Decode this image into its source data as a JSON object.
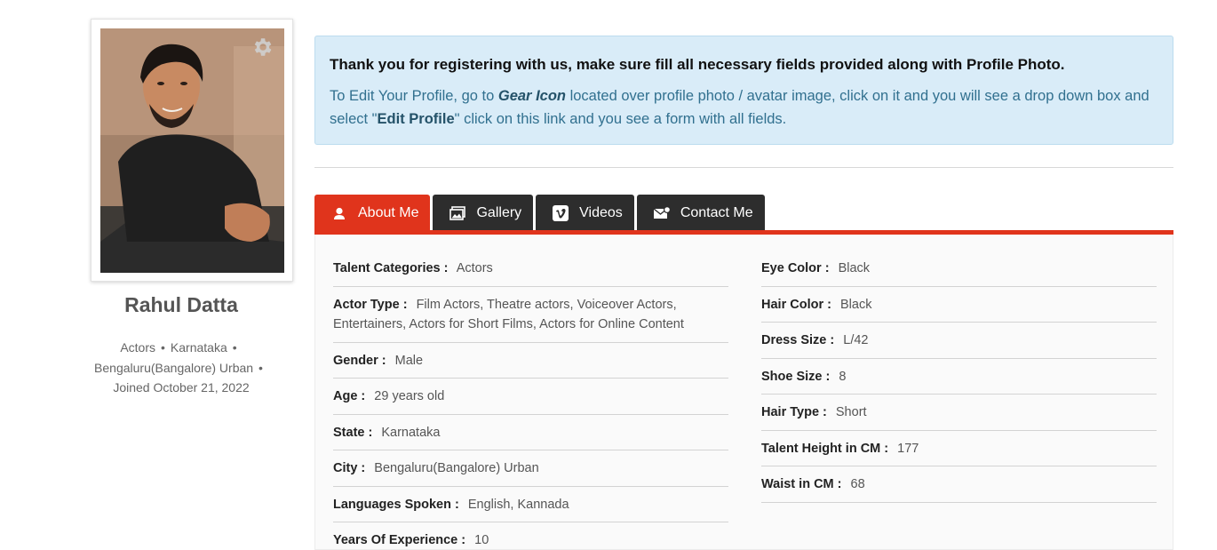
{
  "profile": {
    "name": "Rahul Datta",
    "meta_line1_a": "Actors",
    "meta_line1_b": "Karnataka",
    "meta_line2": "Bengaluru(Bangalore) Urban",
    "meta_line3": "Joined October 21, 2022",
    "separator": "•",
    "gear_icon": "gear-icon"
  },
  "notice": {
    "title": "Thank you for registering with us, make sure fill all necessary fields provided along with Profile Photo.",
    "text_1": "To Edit Your Profile, go to ",
    "gear_label": "Gear Icon",
    "text_2": " located over profile photo / avatar image, click on it and you will see a drop down box and select \"",
    "edit_label": "Edit Profile",
    "text_3": "\" click on this link and you see a form with all fields."
  },
  "tabs": [
    {
      "label": "About Me",
      "icon": "user-icon",
      "active": true
    },
    {
      "label": "Gallery",
      "icon": "image-icon",
      "active": false
    },
    {
      "label": "Videos",
      "icon": "vimeo-icon",
      "active": false
    },
    {
      "label": "Contact Me",
      "icon": "mail-icon",
      "active": false
    }
  ],
  "about_left": [
    {
      "label": "Talent Categories :",
      "value": "Actors"
    },
    {
      "label": "Actor Type :",
      "value": "Film Actors, Theatre actors, Voiceover Actors, Entertainers, Actors for Short Films, Actors for Online Content"
    },
    {
      "label": "Gender :",
      "value": "Male"
    },
    {
      "label": "Age :",
      "value": "29 years old"
    },
    {
      "label": "State :",
      "value": "Karnataka"
    },
    {
      "label": "City :",
      "value": "Bengaluru(Bangalore) Urban"
    },
    {
      "label": "Languages Spoken :",
      "value": "English, Kannada"
    },
    {
      "label": "Years Of Experience :",
      "value": "10"
    }
  ],
  "about_right": [
    {
      "label": "Eye Color :",
      "value": "Black"
    },
    {
      "label": "Hair Color :",
      "value": "Black"
    },
    {
      "label": "Dress Size :",
      "value": "L/42"
    },
    {
      "label": "Shoe Size :",
      "value": "8"
    },
    {
      "label": "Hair Type :",
      "value": "Short"
    },
    {
      "label": "Talent Height in CM :",
      "value": "177"
    },
    {
      "label": "Waist in CM :",
      "value": "68"
    }
  ],
  "colors": {
    "accent": "#e0341c",
    "tab_dark": "#2d2d2d",
    "notice_bg": "#d9ecf8"
  }
}
